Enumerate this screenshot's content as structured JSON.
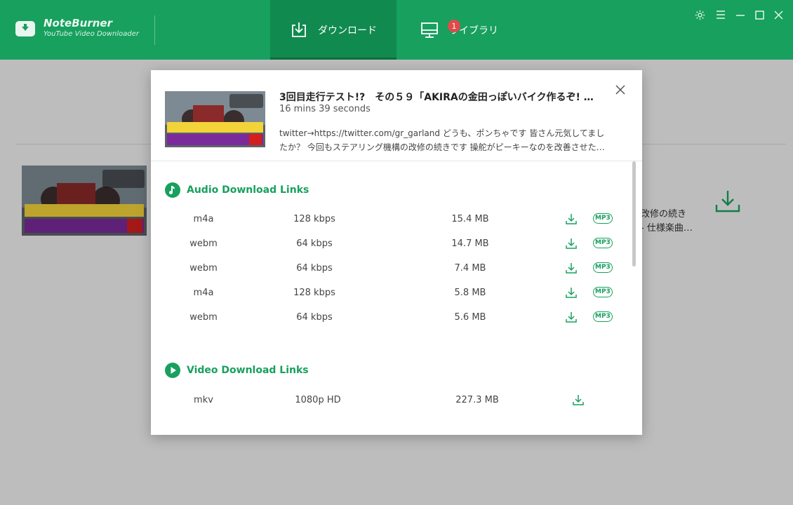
{
  "app": {
    "brand_name": "NoteBurner",
    "brand_sub": "YouTube Video Downloader",
    "accent": "#17a05e"
  },
  "tabs": {
    "download": "ダウンロード",
    "library": "ライブラリ",
    "library_badge": "1"
  },
  "window_controls": [
    "gear-icon",
    "menu-icon",
    "minimize-icon",
    "maximize-icon",
    "close-icon"
  ],
  "background": {
    "desc_line1": "改修の続き",
    "desc_line2": "- 仕様楽曲…"
  },
  "dialog": {
    "title": "3回目走行テスト!?　その５９「AKIRAの金田っぽいバイク作るぞ! …",
    "duration": "16 mins 39 seconds",
    "desc_line1": "twitter→https://twitter.com/gr_garland どうも、ポンちゃです 皆さん元気してまし",
    "desc_line2": "たか？ 今回もステアリング機構の改修の続きです 操舵がピーキーなのを改善させた…",
    "audio_heading": "Audio Download Links",
    "video_heading": "Video Download Links",
    "mp3_label": "MP3",
    "audio_rows": [
      {
        "format": "m4a",
        "quality": "128 kbps",
        "size": "15.4 MB"
      },
      {
        "format": "webm",
        "quality": "64 kbps",
        "size": "14.7 MB"
      },
      {
        "format": "webm",
        "quality": "64 kbps",
        "size": "7.4 MB"
      },
      {
        "format": "m4a",
        "quality": "128 kbps",
        "size": "5.8 MB"
      },
      {
        "format": "webm",
        "quality": "64 kbps",
        "size": "5.6 MB"
      }
    ],
    "video_rows": [
      {
        "format": "mkv",
        "quality": "1080p HD",
        "size": "227.3 MB"
      }
    ]
  }
}
